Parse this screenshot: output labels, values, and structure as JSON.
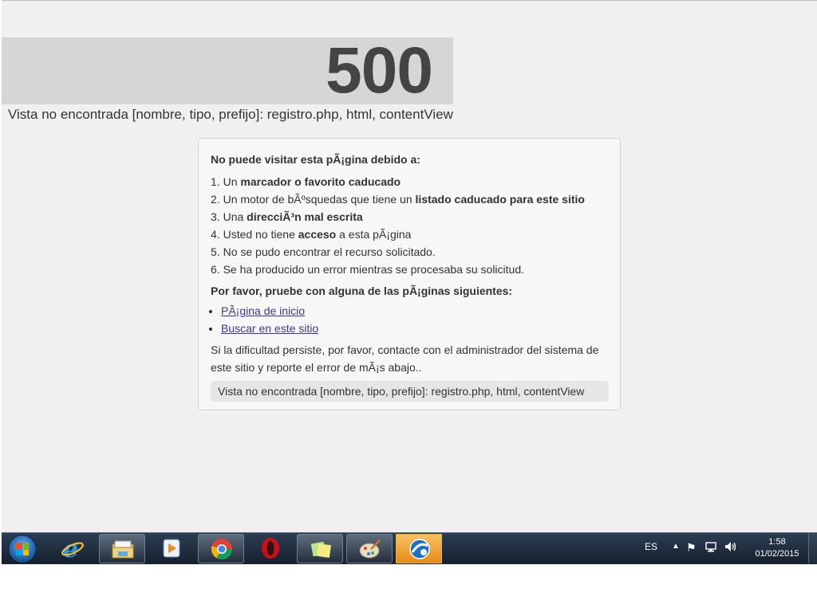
{
  "error": {
    "code": "500",
    "message": "Vista no encontrada [nombre, tipo, prefijo]: registro.php, html, contentView"
  },
  "panel": {
    "heading": "No puede visitar esta pÃ¡gina debido a:",
    "reasons": [
      {
        "num": "1.",
        "pre": " Un ",
        "bold": "marcador o favorito caducado",
        "post": ""
      },
      {
        "num": "2.",
        "pre": " Un motor de bÃºsquedas que tiene un ",
        "bold": "listado caducado para este sitio",
        "post": ""
      },
      {
        "num": "3.",
        "pre": " Una ",
        "bold": "direcciÃ³n mal escrita",
        "post": ""
      },
      {
        "num": "4.",
        "pre": " Usted no tiene ",
        "bold": "acceso",
        "post": " a esta pÃ¡gina"
      },
      {
        "num": "5.",
        "pre": " No se pudo encontrar el recurso solicitado.",
        "bold": "",
        "post": ""
      },
      {
        "num": "6.",
        "pre": " Se ha producido un error mientras se procesaba su solicitud.",
        "bold": "",
        "post": ""
      }
    ],
    "heading2": "Por favor, pruebe con alguna de las pÃ¡ginas siguientes:",
    "links": [
      {
        "label": "PÃ¡gina de inicio"
      },
      {
        "label": "Buscar en este sitio"
      }
    ],
    "note": "Si la dificultad persiste, por favor, contacte con el administrador del sistema de este sitio y reporte el error de mÃ¡s abajo..",
    "detail": "Vista no encontrada [nombre, tipo, prefijo]: registro.php, html, contentView"
  },
  "taskbar": {
    "items": [
      {
        "name": "internet-explorer-icon"
      },
      {
        "name": "file-explorer-icon"
      },
      {
        "name": "media-player-icon"
      },
      {
        "name": "chrome-icon"
      },
      {
        "name": "opera-icon"
      },
      {
        "name": "sticky-notes-icon"
      },
      {
        "name": "paint-icon"
      },
      {
        "name": "app-icon"
      }
    ],
    "lang": "ES",
    "time": "1:58",
    "date": "01/02/2015"
  },
  "colors": {
    "taskbar_active": "#e58a17",
    "link": "#3b3b8b"
  }
}
